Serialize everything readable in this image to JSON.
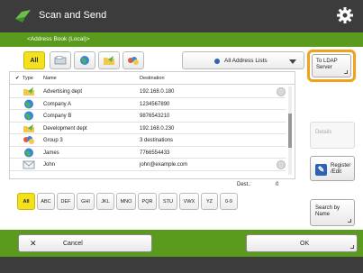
{
  "header": {
    "title": "Scan and Send",
    "subtitle": "<Address Book (Local)>"
  },
  "filters": {
    "all_label": "All",
    "address_list": "All Address Lists"
  },
  "ldap_button": {
    "line1": "To LDAP",
    "line2": "Server"
  },
  "table": {
    "headers": {
      "type": "Type",
      "name": "Name",
      "destination": "Destination"
    },
    "rows": [
      {
        "name": "Advertising dept",
        "destination": "192.168.0.180"
      },
      {
        "name": "Company A",
        "destination": "1234567890"
      },
      {
        "name": "Company B",
        "destination": "9876543210"
      },
      {
        "name": "Development dept",
        "destination": "192.168.0.230"
      },
      {
        "name": "Group 3",
        "destination": "3 destinations"
      },
      {
        "name": "James",
        "destination": "7766554433"
      },
      {
        "name": "John",
        "destination": "john@example.com"
      }
    ]
  },
  "dest_count": {
    "label": "Dest.:",
    "value": "0"
  },
  "alphabet": [
    "All",
    "ABC",
    "DEF",
    "GHI",
    "JKL",
    "MNO",
    "PQR",
    "STU",
    "VWX",
    "YZ",
    "0-9"
  ],
  "side": {
    "details": "Details",
    "register_line1": "Register",
    "register_line2": "/Edit",
    "search_line1": "Search by",
    "search_line2": "Name"
  },
  "footer": {
    "cancel": "Cancel",
    "ok": "OK"
  },
  "colors": {
    "accent_green": "#5a9a1c",
    "highlight_orange": "#f0a21a",
    "selected_yellow": "#f2e11c",
    "header_dark": "#3c3c3c"
  }
}
